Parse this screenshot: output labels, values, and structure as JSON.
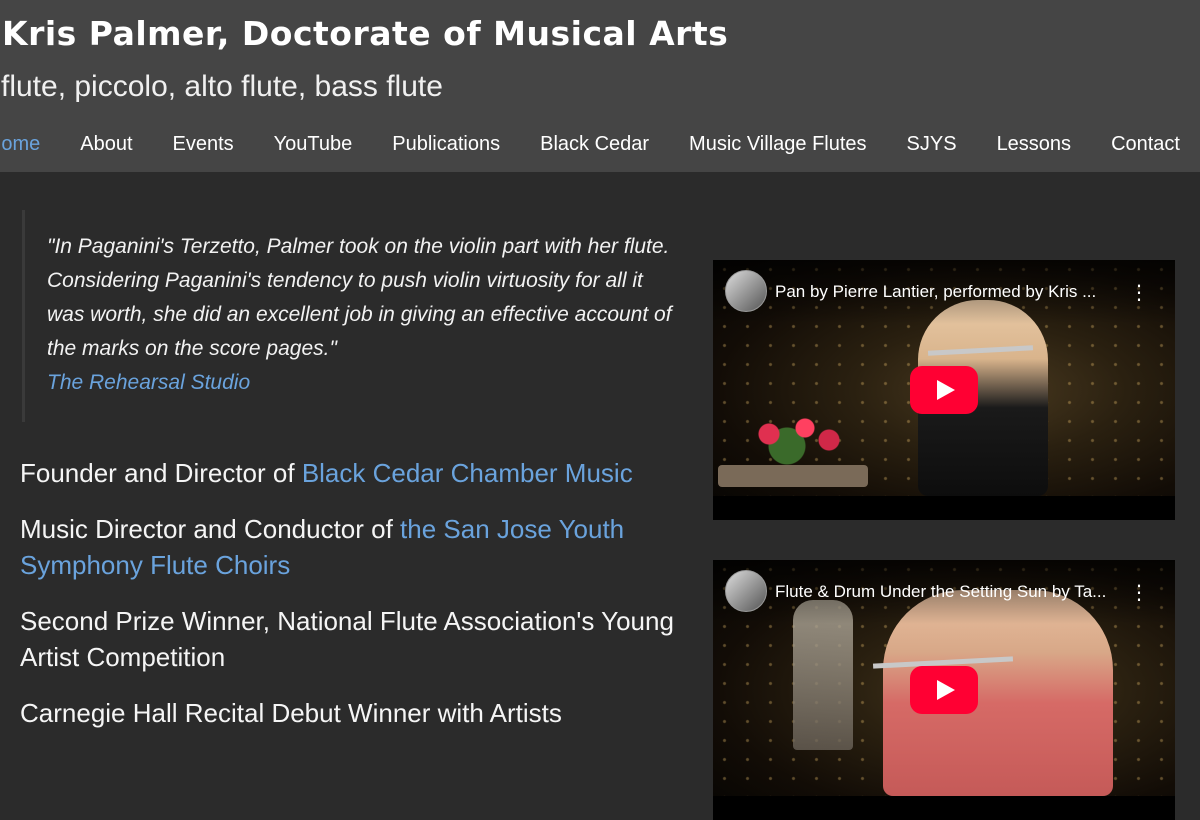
{
  "header": {
    "title": "Kris Palmer, Doctorate of Musical Arts",
    "subtitle": "flute, piccolo, alto flute, bass flute"
  },
  "nav": {
    "items": [
      {
        "label": "Home",
        "active": true
      },
      {
        "label": "About"
      },
      {
        "label": "Events"
      },
      {
        "label": "YouTube"
      },
      {
        "label": "Publications"
      },
      {
        "label": "Black Cedar"
      },
      {
        "label": "Music Village Flutes"
      },
      {
        "label": "SJYS"
      },
      {
        "label": "Lessons"
      },
      {
        "label": "Contact"
      }
    ]
  },
  "quote": {
    "text": "\"In Paganini's Terzetto, Palmer took on the violin part with her flute. Considering Paganini's tendency to push violin virtuosity for all it was worth, she did an excellent job in giving an effective account of the marks on the score pages.\"",
    "source": "The Rehearsal Studio"
  },
  "facts": [
    {
      "prefix": "Founder and Director of ",
      "link": "Black Cedar Chamber Music"
    },
    {
      "prefix": "Music Director and Conductor of ",
      "link": "the San Jose Youth Symphony Flute Choirs"
    },
    {
      "prefix": "Second Prize Winner, National Flute Association's Young Artist Competition",
      "link": ""
    },
    {
      "prefix": "Carnegie Hall Recital Debut Winner with Artists",
      "link": ""
    }
  ],
  "videos": [
    {
      "title": "Pan by Pierre Lantier, performed by Kris ...",
      "menu_icon": "kebab-menu-icon",
      "play_icon": "youtube-play-icon"
    },
    {
      "title": "Flute & Drum Under the Setting Sun by Ta...",
      "menu_icon": "kebab-menu-icon",
      "play_icon": "youtube-play-icon"
    }
  ],
  "colors": {
    "header_bg": "#454545",
    "page_bg": "#2b2b2b",
    "link": "#6aa3dd",
    "youtube_red": "#ff0033"
  }
}
